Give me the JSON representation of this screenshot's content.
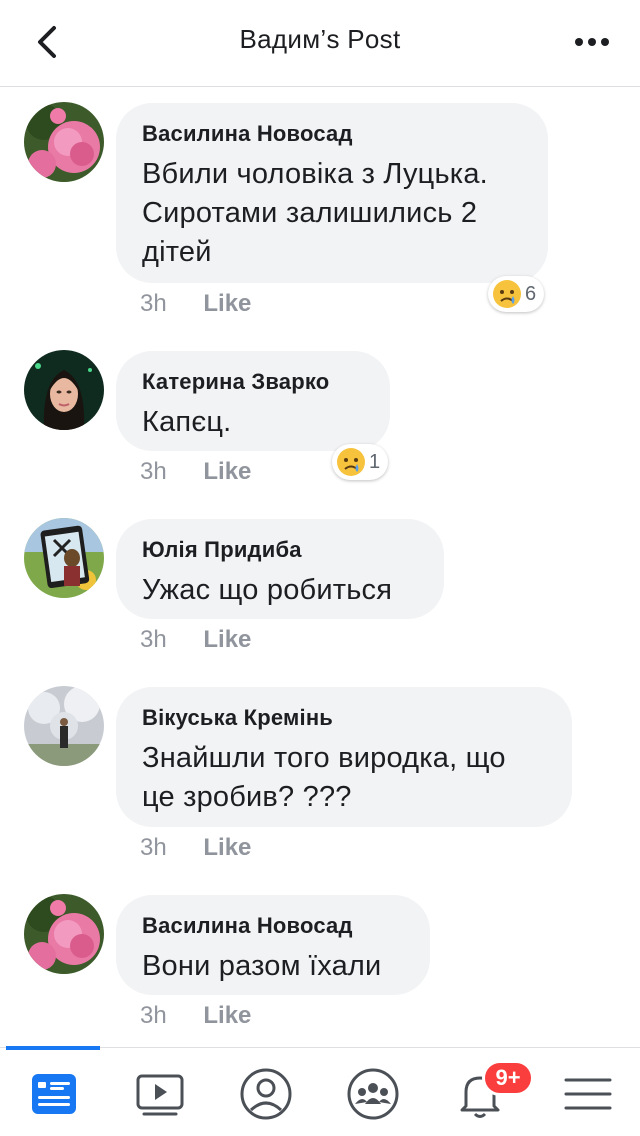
{
  "header": {
    "title": "Вадим’s Post"
  },
  "comments": [
    {
      "name": "Василина Новосад",
      "text": "Вбили чоловіка з Луцька. Сиротами залишились 2 дітей",
      "time": "3h",
      "like": "Like",
      "reaction_count": "6"
    },
    {
      "name": "Катерина Зварко",
      "text": "Капєц.",
      "time": "3h",
      "like": "Like",
      "reaction_count": "1"
    },
    {
      "name": "Юлія Придиба",
      "text": "Ужас що робиться",
      "time": "3h",
      "like": "Like"
    },
    {
      "name": "Вікуська Кремінь",
      "text": "Знайшли того виродка, що це зробив? ???",
      "time": "3h",
      "like": "Like"
    },
    {
      "name": "Василина Новосад",
      "text": "Вони разом їхали",
      "time": "3h",
      "like": "Like"
    }
  ],
  "tabbar": {
    "notifications_badge": "9+"
  },
  "colors": {
    "accent": "#1877f2",
    "bubble": "#f2f3f5",
    "badge": "#fa3e3e"
  }
}
